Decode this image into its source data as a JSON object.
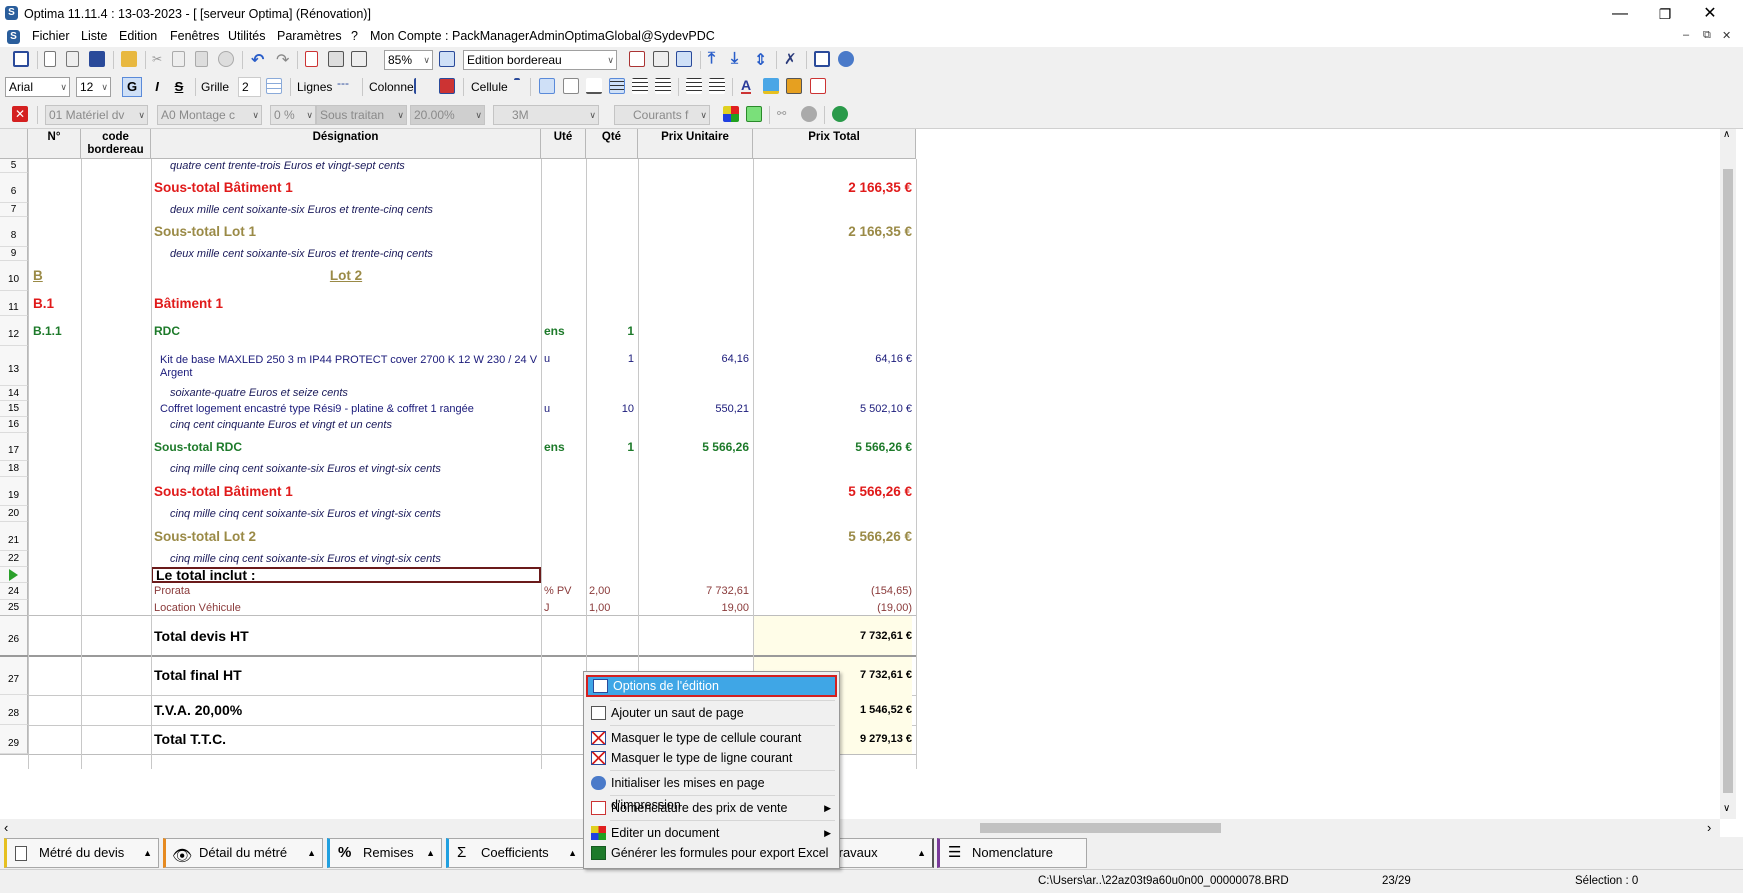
{
  "window": {
    "title": "Optima 11.11.4 : 13-03-2023 - [ [serveur Optima] (Rénovation)]",
    "minimize": "—",
    "restore": "❐",
    "close": "✕"
  },
  "menu": {
    "items": [
      "Fichier",
      "Liste",
      "Edition",
      "Fenêtres",
      "Utilités",
      "Paramètres",
      "?"
    ],
    "account": "Mon Compte : PackManagerAdminOptimaGlobal@SydevPDC"
  },
  "toolbar1": {
    "zoom": "85%",
    "view": "Edition bordereau"
  },
  "toolbar2": {
    "font": "Arial",
    "size": "12",
    "bold": "G",
    "italic": "I",
    "strike": "S",
    "grille_label": "Grille",
    "grille_value": "2",
    "lignes_label": "Lignes",
    "colonne_label": "Colonne",
    "cellule_label": "Cellule"
  },
  "toolbar3": {
    "materiel": "01  Matériel dv",
    "montage": "A0  Montage c",
    "pct": "0 %",
    "sous_traitance": "Sous traitan",
    "tva": "20.00%",
    "three_m": "3M",
    "courants": "Courants f"
  },
  "grid": {
    "headers": {
      "num": "N°",
      "code": "code bordereau",
      "designation": "Désignation",
      "ute": "Uté",
      "qte": "Qté",
      "pu": "Prix Unitaire",
      "total": "Prix Total"
    },
    "rows": [
      {
        "n": "5",
        "designation": "quatre cent trente-trois Euros et vingt-sept cents"
      },
      {
        "n": "6",
        "designation": "Sous-total Bâtiment 1",
        "total": "2 166,35 €"
      },
      {
        "n": "7",
        "designation": "deux mille cent soixante-six Euros et trente-cinq cents"
      },
      {
        "n": "8",
        "designation": "Sous-total Lot 1",
        "total": "2 166,35 €"
      },
      {
        "n": "9",
        "designation": "deux mille cent soixante-six Euros et trente-cinq cents"
      },
      {
        "n": "10",
        "num": "B",
        "designation": "Lot 2"
      },
      {
        "n": "11",
        "num": "B.1",
        "designation": "Bâtiment 1"
      },
      {
        "n": "12",
        "num": "B.1.1",
        "designation": "RDC",
        "ute": "ens",
        "qte": "1"
      },
      {
        "n": "13",
        "designation": "Kit de base MAXLED 250 3 m IP44 PROTECT cover 2700 K 12 W 230 / 24 V",
        "designation2": "Argent",
        "ute": "u",
        "qte": "1",
        "pu": "64,16",
        "total": "64,16 €"
      },
      {
        "n": "14",
        "designation": "soixante-quatre Euros et seize cents"
      },
      {
        "n": "15",
        "designation": "Coffret logement encastré type Rési9 - platine & coffret 1 rangée",
        "ute": "u",
        "qte": "10",
        "pu": "550,21",
        "total": "5 502,10 €"
      },
      {
        "n": "16",
        "designation": "cinq cent cinquante Euros et vingt et un cents"
      },
      {
        "n": "17",
        "designation": "Sous-total RDC",
        "ute": "ens",
        "qte": "1",
        "pu": "5 566,26",
        "total": "5 566,26 €"
      },
      {
        "n": "18",
        "designation": "cinq mille cinq cent soixante-six Euros et vingt-six cents"
      },
      {
        "n": "19",
        "designation": "Sous-total Bâtiment 1",
        "total": "5 566,26 €"
      },
      {
        "n": "20",
        "designation": "cinq mille cinq cent soixante-six Euros et vingt-six cents"
      },
      {
        "n": "21",
        "designation": "Sous-total Lot 2",
        "total": "5 566,26 €"
      },
      {
        "n": "22",
        "designation": "cinq mille cinq cent soixante-six Euros et vingt-six cents"
      },
      {
        "n": "",
        "designation": "Le total inclut :"
      },
      {
        "n": "24",
        "designation": "Prorata",
        "ute": "% PV",
        "qte": "2,00",
        "pu": "7 732,61",
        "total": "(154,65)"
      },
      {
        "n": "25",
        "designation": "Location Véhicule",
        "ute": "J",
        "qte": "1,00",
        "pu": "19,00",
        "total": "(19,00)"
      },
      {
        "n": "26",
        "designation": "Total devis HT",
        "total": "7 732,61 €"
      },
      {
        "n": "27",
        "designation": "Total final HT",
        "total": "7 732,61 €"
      },
      {
        "n": "28",
        "designation": "T.V.A. 20,00%",
        "total": "1 546,52 €"
      },
      {
        "n": "29",
        "designation": "Total  T.T.C.",
        "total": "9 279,13 €"
      }
    ]
  },
  "context_menu": {
    "items": [
      {
        "label": "Options de l'édition",
        "icon": "options-icon"
      },
      {
        "label": "Ajouter un saut de page",
        "icon": "page-break-icon"
      },
      {
        "label": "Masquer le type de cellule courant",
        "icon": "hide-cell-icon"
      },
      {
        "label": "Masquer le type de ligne courant",
        "icon": "hide-line-icon"
      },
      {
        "label": "Initialiser les mises en page d'impression",
        "icon": "refresh-icon"
      },
      {
        "label": "Nomenclature des prix de vente",
        "icon": "nomenclature-icon"
      },
      {
        "label": "Editer un document",
        "icon": "document-icon"
      },
      {
        "label": "Générer les formules pour export Excel",
        "icon": "excel-icon"
      }
    ]
  },
  "tabs": [
    {
      "label": "Métré du devis"
    },
    {
      "label": "Détail du métré"
    },
    {
      "label": "Remises"
    },
    {
      "label": "Coefficients"
    },
    {
      "label": "travaux"
    },
    {
      "label": "Nomenclature"
    }
  ],
  "status": {
    "path": "C:\\Users\\ar..\\22az03t9a60u0n00_00000078.BRD",
    "position": "23/29",
    "selection": "Sélection : 0"
  },
  "colors": {
    "red": "#e01a1a",
    "olive": "#9a8a46",
    "green": "#1d7a2a",
    "navy": "#1a1a7a",
    "brown": "#8a3a3a",
    "highlight": "#3fa6e6"
  }
}
